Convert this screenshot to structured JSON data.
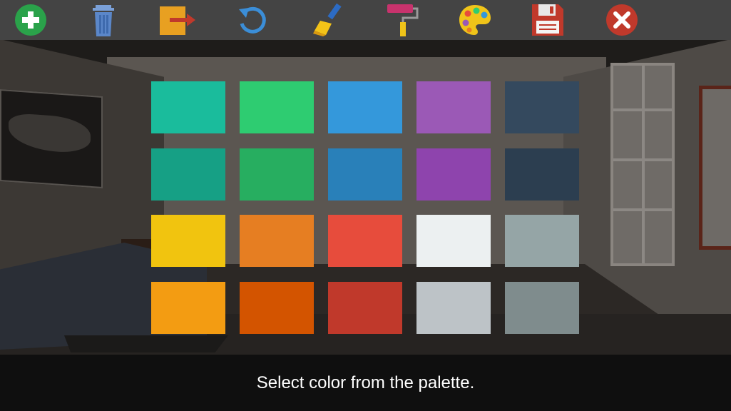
{
  "toolbar": {
    "tools": [
      {
        "name": "add",
        "icon": "plus-circle-icon"
      },
      {
        "name": "delete",
        "icon": "trash-icon"
      },
      {
        "name": "export",
        "icon": "export-arrow-icon"
      },
      {
        "name": "undo",
        "icon": "rotate-icon"
      },
      {
        "name": "brush",
        "icon": "paint-brush-icon"
      },
      {
        "name": "roller",
        "icon": "paint-roller-icon"
      },
      {
        "name": "palette",
        "icon": "palette-icon"
      },
      {
        "name": "save",
        "icon": "floppy-disk-icon"
      },
      {
        "name": "close",
        "icon": "close-icon"
      }
    ]
  },
  "palette": {
    "colors": [
      [
        "#1abc9c",
        "#2ecc71",
        "#3498db",
        "#9b59b6",
        "#34495e"
      ],
      [
        "#16a085",
        "#27ae60",
        "#2980b9",
        "#8e44ad",
        "#2c3e50"
      ],
      [
        "#f1c40f",
        "#e67e22",
        "#e74c3c",
        "#ecf0f1",
        "#95a5a6"
      ],
      [
        "#f39c12",
        "#d35400",
        "#c0392b",
        "#bdc3c7",
        "#7f8c8d"
      ]
    ]
  },
  "hint": {
    "text": "Select color from the palette."
  }
}
